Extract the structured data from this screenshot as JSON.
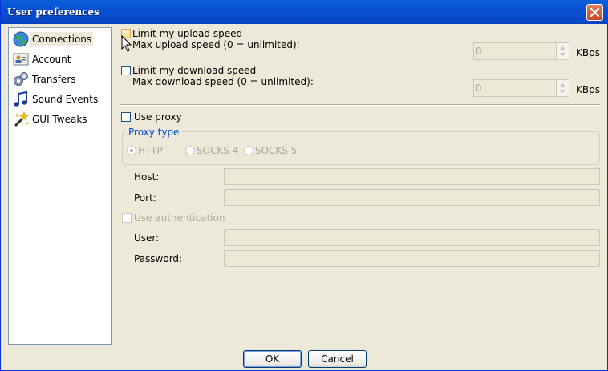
{
  "window": {
    "title": "User preferences"
  },
  "sidebar": {
    "items": [
      {
        "label": "Connections",
        "icon": "globe-network-icon",
        "selected": true
      },
      {
        "label": "Account",
        "icon": "user-card-icon",
        "selected": false
      },
      {
        "label": "Transfers",
        "icon": "gears-icon",
        "selected": false
      },
      {
        "label": "Sound Events",
        "icon": "music-note-icon",
        "selected": false
      },
      {
        "label": "GUI Tweaks",
        "icon": "paint-sparkle-icon",
        "selected": false
      }
    ]
  },
  "connections": {
    "upload": {
      "checkbox_label": "Limit my upload speed",
      "checked": false,
      "max_label": "Max upload speed (0 = unlimited):",
      "value": "0",
      "unit": "KBps"
    },
    "download": {
      "checkbox_label": "Limit my download speed",
      "checked": false,
      "max_label": "Max download speed (0 = unlimited):",
      "value": "0",
      "unit": "KBps"
    },
    "proxy": {
      "use_proxy_label": "Use proxy",
      "use_proxy_checked": false,
      "type_group_label": "Proxy type",
      "types": [
        "HTTP",
        "SOCKS 4",
        "SOCKS 5"
      ],
      "selected_type": "HTTP",
      "host_label": "Host:",
      "host_value": "",
      "port_label": "Port:",
      "port_value": "",
      "auth_label": "Use authentication",
      "auth_checked": false,
      "user_label": "User:",
      "user_value": "",
      "password_label": "Password:",
      "password_value": ""
    }
  },
  "buttons": {
    "ok": "OK",
    "cancel": "Cancel"
  },
  "colors": {
    "titlebar": "#0a5fd8",
    "dialog_bg": "#ece9d8",
    "group_title": "#0046d5",
    "disabled_text": "#aca899"
  }
}
